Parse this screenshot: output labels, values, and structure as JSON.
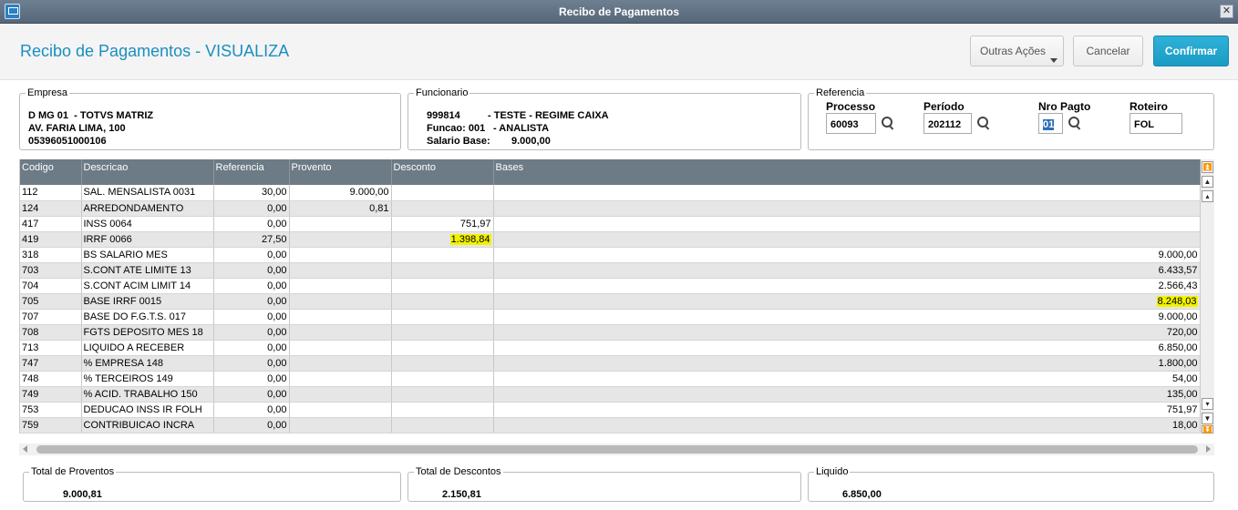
{
  "window": {
    "title": "Recibo de Pagamentos"
  },
  "header": {
    "page_title": "Recibo de Pagamentos - VISUALIZA",
    "buttons": {
      "outras": "Outras Ações",
      "cancelar": "Cancelar",
      "confirmar": "Confirmar"
    }
  },
  "empresa": {
    "legend": "Empresa",
    "line1": "D MG 01  - TOTVS MATRIZ",
    "line2": "AV. FARIA LIMA, 100",
    "line3": "05396051000106"
  },
  "funcionario": {
    "legend": "Funcionario",
    "matricula": "999814",
    "nome": "- TESTE - REGIME CAIXA",
    "funcao_label": "Funcao: 001",
    "funcao_nome": "- ANALISTA",
    "salario_label": "Salario Base:",
    "salario_valor": "9.000,00"
  },
  "referencia": {
    "legend": "Referencia",
    "processo_label": "Processo",
    "processo_value": "60093",
    "periodo_label": "Período",
    "periodo_value": "202112",
    "nro_pagto_label": "Nro Pagto",
    "nro_pagto_value": "01",
    "roteiro_label": "Roteiro",
    "roteiro_value": "FOL"
  },
  "grid": {
    "columns": [
      "Codigo",
      "Descricao",
      "Referencia",
      "Provento",
      "Desconto",
      "Bases"
    ],
    "rows": [
      [
        "112",
        "SAL. MENSALISTA 0031",
        "30,00",
        "9.000,00",
        "",
        ""
      ],
      [
        "124",
        "ARREDONDAMENTO",
        "0,00",
        "0,81",
        "",
        ""
      ],
      [
        "417",
        "INSS 0064",
        "0,00",
        "",
        "751,97",
        ""
      ],
      [
        "419",
        "IRRF 0066",
        "27,50",
        "",
        "1.398,84",
        ""
      ],
      [
        "318",
        "BS SALARIO MES",
        "0,00",
        "",
        "",
        "9.000,00"
      ],
      [
        "703",
        "S.CONT ATE LIMITE 13",
        "0,00",
        "",
        "",
        "6.433,57"
      ],
      [
        "704",
        "S.CONT ACIM LIMIT 14",
        "0,00",
        "",
        "",
        "2.566,43"
      ],
      [
        "705",
        "BASE IRRF 0015",
        "0,00",
        "",
        "",
        "8.248,03"
      ],
      [
        "707",
        "BASE DO F.G.T.S. 017",
        "0,00",
        "",
        "",
        "9.000,00"
      ],
      [
        "708",
        "FGTS DEPOSITO MES 18",
        "0,00",
        "",
        "",
        "720,00"
      ],
      [
        "713",
        "LIQUIDO A RECEBER",
        "0,00",
        "",
        "",
        "6.850,00"
      ],
      [
        "747",
        "% EMPRESA  148",
        "0,00",
        "",
        "",
        "1.800,00"
      ],
      [
        "748",
        "% TERCEIROS 149",
        "0,00",
        "",
        "",
        "54,00"
      ],
      [
        "749",
        "% ACID. TRABALHO 150",
        "0,00",
        "",
        "",
        "135,00"
      ],
      [
        "753",
        "DEDUCAO INSS IR FOLH",
        "0,00",
        "",
        "",
        "751,97"
      ],
      [
        "759",
        "CONTRIBUICAO INCRA",
        "0,00",
        "",
        "",
        "18,00"
      ]
    ],
    "highlights": [
      "1.398,84",
      "8.248,03"
    ],
    "highlight_color": "#f2f200"
  },
  "totals": {
    "proventos_label": "Total de Proventos",
    "proventos_value": "9.000,81",
    "descontos_label": "Total de Descontos",
    "descontos_value": "2.150,81",
    "liquido_label": "Liquido",
    "liquido_value": "6.850,00"
  },
  "colors": {
    "title_blue": "#1a8fbf",
    "confirm_blue": "#1a9bc4",
    "grid_header": "#6c7b86"
  }
}
